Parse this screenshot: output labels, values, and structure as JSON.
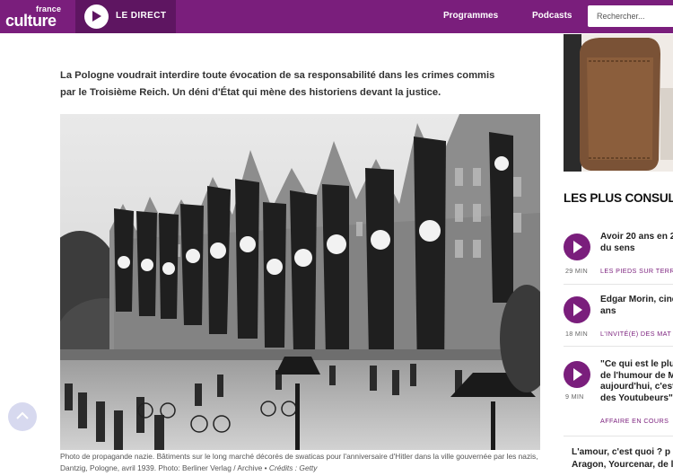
{
  "header": {
    "logo_top": "france",
    "logo_bottom": "culture",
    "live_label": "LE DIRECT",
    "nav": [
      "Programmes",
      "Podcasts"
    ],
    "search_placeholder": "Rechercher..."
  },
  "article": {
    "chapo": "La Pologne voudrait interdire toute évocation de sa responsabilité dans les crimes commis par le Troisième Reich. Un déni d'État qui mène des historiens devant la justice.",
    "caption": "Photo de propagande nazie. Bâtiments sur le long marché décorés de swaticas pour l'anniversaire d'Hitler dans la ville gouvernée par les nazis, Dantzig, Pologne, avril 1939. Photo: Berliner Verlag / Archive  •  ",
    "credits": "Crédits : Getty"
  },
  "sidebar": {
    "most_consulted_title": "LES PLUS CONSULT",
    "items": [
      {
        "title_lines": [
          "Avoir 20 ans en 2",
          "du sens"
        ],
        "duration": "29 MIN",
        "show": "LES PIEDS SUR TERR"
      },
      {
        "title_lines": [
          "Edgar Morin, cinq",
          "ans"
        ],
        "duration": "18 MIN",
        "show": "L'INVITÉ(E) DES MAT"
      },
      {
        "title_lines": [
          "\"Ce qui est le plus",
          "de l'humour de M",
          "aujourd'hui, c'est",
          "des Youtubeurs\""
        ],
        "duration": "9 MIN",
        "show": "AFFAIRE EN COURS"
      }
    ],
    "bottom_teaser_lines": [
      "L'amour, c'est quoi ? p",
      "Aragon, Yourcenar, de l"
    ]
  },
  "colors": {
    "brand_purple": "#7a1e7c",
    "live_bg": "#5e1561",
    "scroll_button": "#d7d9ef"
  }
}
